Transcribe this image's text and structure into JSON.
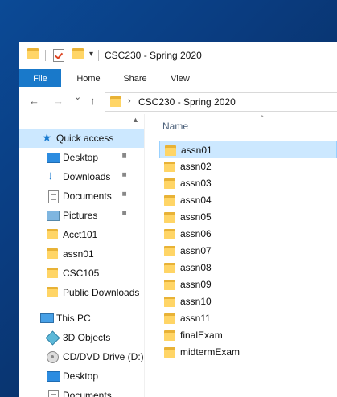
{
  "window": {
    "title": "CSC230 - Spring 2020",
    "qa_toolbar_arrow": "▾"
  },
  "ribbon": {
    "tabs": [
      "File",
      "Home",
      "Share",
      "View"
    ]
  },
  "nav": {
    "back_glyph": "←",
    "forward_glyph": "→",
    "recent_glyph": "⌄",
    "up_glyph": "↑",
    "breadcrumb_sep": "›",
    "path": "CSC230 - Spring 2020"
  },
  "sidebar": {
    "quick_access": "Quick access",
    "items": [
      {
        "label": "Desktop",
        "icon": "desktop-icon",
        "pinned": true
      },
      {
        "label": "Downloads",
        "icon": "download-icon",
        "pinned": true
      },
      {
        "label": "Documents",
        "icon": "documents-icon",
        "pinned": true
      },
      {
        "label": "Pictures",
        "icon": "pictures-icon",
        "pinned": true
      },
      {
        "label": "Acct101",
        "icon": "folder-icon",
        "pinned": false
      },
      {
        "label": "assn01",
        "icon": "folder-icon",
        "pinned": false
      },
      {
        "label": "CSC105",
        "icon": "folder-icon",
        "pinned": false
      },
      {
        "label": "Public Downloads",
        "icon": "folder-icon",
        "pinned": false
      }
    ],
    "this_pc": "This PC",
    "pc_items": [
      {
        "label": "3D Objects",
        "icon": "3d-objects-icon"
      },
      {
        "label": "CD/DVD Drive (D:)",
        "icon": "cd-drive-icon"
      },
      {
        "label": "Desktop",
        "icon": "desktop-icon"
      },
      {
        "label": "Documents",
        "icon": "documents-icon"
      }
    ],
    "pin_glyph": "📌"
  },
  "files": {
    "column_header": "Name",
    "sort_glyph": "⌃",
    "items": [
      "assn01",
      "assn02",
      "assn03",
      "assn04",
      "assn05",
      "assn06",
      "assn07",
      "assn08",
      "assn09",
      "assn10",
      "assn11",
      "finalExam",
      "midtermExam"
    ],
    "selected": "assn01"
  }
}
